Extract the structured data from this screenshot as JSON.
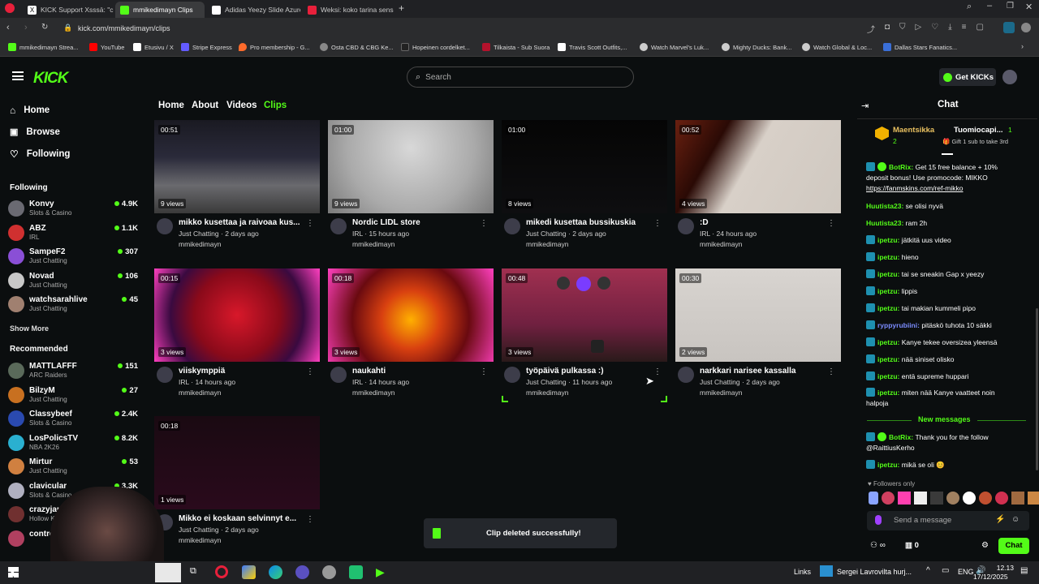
{
  "browser": {
    "tabs": [
      {
        "label": "KICK Support Xsssā: \"chec",
        "color": "#e0e0e0"
      },
      {
        "label": "mmikedimayn Clips",
        "color": "#53fc18"
      },
      {
        "label": "Adidas Yeezy Slide Azure",
        "color": "#ffffff"
      },
      {
        "label": "Weksi: koko tarina sensur",
        "color": "#e8203b"
      }
    ],
    "url": "kick.com/mmikedimayn/clips",
    "bookmarks": [
      {
        "label": "mmikedimayn Strea...",
        "color": "#53fc18"
      },
      {
        "label": "YouTube",
        "color": "#ff0000"
      },
      {
        "label": "Etusivu / X",
        "color": "#ffffff"
      },
      {
        "label": "Stripe Express",
        "color": "#635bff"
      },
      {
        "label": "Pro membership - G...",
        "color": "#ff6b2b"
      },
      {
        "label": "Osta CBD & CBG Ke...",
        "color": "#888888"
      },
      {
        "label": "Hopeinen cordelket...",
        "color": "#222222"
      },
      {
        "label": "Tilkaista - Sub Suora",
        "color": "#b3122c"
      },
      {
        "label": "Travis Scott Outfits,...",
        "color": "#ffffff"
      },
      {
        "label": "Watch Marvel's Luk...",
        "color": "#cccccc"
      },
      {
        "label": "Mighty Ducks: Bank...",
        "color": "#cccccc"
      },
      {
        "label": "Watch Global & Loc...",
        "color": "#cccccc"
      },
      {
        "label": "Dallas Stars Fanatics...",
        "color": "#3a6fd8"
      }
    ]
  },
  "header": {
    "logo": "KICK",
    "search_placeholder": "Search",
    "get_kicks": "Get KICKs"
  },
  "sidebar": {
    "nav": [
      {
        "label": "Home",
        "icon": "home-icon"
      },
      {
        "label": "Browse",
        "icon": "browse-icon"
      },
      {
        "label": "Following",
        "icon": "heart-icon"
      }
    ],
    "following_title": "Following",
    "following": [
      {
        "name": "Konvy",
        "category": "Slots & Casino",
        "viewers": "4.9K",
        "color": "#6a6a72"
      },
      {
        "name": "ABZ",
        "category": "IRL",
        "viewers": "1.1K",
        "color": "#d03030"
      },
      {
        "name": "SampeF2",
        "category": "Just Chatting",
        "viewers": "307",
        "color": "#8a4fd6"
      },
      {
        "name": "Novad",
        "category": "Just Chatting",
        "viewers": "106",
        "color": "#c8c8c8"
      },
      {
        "name": "watchsarahlive",
        "category": "Just Chatting",
        "viewers": "45",
        "color": "#a08070"
      }
    ],
    "show_more": "Show More",
    "recommended_title": "Recommended",
    "recommended": [
      {
        "name": "MATTLAFFF",
        "category": "ARC Raiders",
        "viewers": "151",
        "color": "#5a6a5a"
      },
      {
        "name": "BilzyM",
        "category": "Just Chatting",
        "viewers": "27",
        "color": "#c87020"
      },
      {
        "name": "Classybeef",
        "category": "Slots & Casino",
        "viewers": "2.4K",
        "color": "#2a4ab0"
      },
      {
        "name": "LosPolicsTV",
        "category": "NBA 2K26",
        "viewers": "8.2K",
        "color": "#2ab0d0"
      },
      {
        "name": "Mirtur",
        "category": "Just Chatting",
        "viewers": "53",
        "color": "#d08040"
      },
      {
        "name": "clavicular",
        "category": "Slots & Casino",
        "viewers": "3.3K",
        "color": "#b0b0c0"
      },
      {
        "name": "crazyjapane",
        "category": "Hollow Knigh",
        "viewers": "",
        "color": "#703030"
      },
      {
        "name": "contro",
        "category": "",
        "viewers": "",
        "color": "#b04060"
      }
    ]
  },
  "page_tabs": [
    "Home",
    "About",
    "Videos",
    "Clips"
  ],
  "clips": [
    {
      "duration": "00:51",
      "views": "9 views",
      "title": "mikko kusettaa ja raivoaa kus...",
      "category": "Just Chatting",
      "age": "2 days ago",
      "channel": "mmikedimayn"
    },
    {
      "duration": "01:00",
      "views": "9 views",
      "title": "Nordic LIDL store",
      "category": "IRL",
      "age": "15 hours ago",
      "channel": "mmikedimayn"
    },
    {
      "duration": "01:00",
      "views": "8 views",
      "title": "mikedi kusettaa bussikuskia",
      "category": "Just Chatting",
      "age": "2 days ago",
      "channel": "mmikedimayn"
    },
    {
      "duration": "00:52",
      "views": "4 views",
      "title": ":D",
      "category": "IRL",
      "age": "24 hours ago",
      "channel": "mmikedimayn"
    },
    {
      "duration": "00:15",
      "views": "3 views",
      "title": "viiskymppiä",
      "category": "IRL",
      "age": "14 hours ago",
      "channel": "mmikedimayn"
    },
    {
      "duration": "00:18",
      "views": "3 views",
      "title": "naukahti",
      "category": "IRL",
      "age": "14 hours ago",
      "channel": "mmikedimayn"
    },
    {
      "duration": "00:48",
      "views": "3 views",
      "title": "työpäivä pulkassa :)",
      "category": "Just Chatting",
      "age": "11 hours ago",
      "channel": "mmikedimayn"
    },
    {
      "duration": "00:30",
      "views": "2 views",
      "title": "narkkari narisee kassalla",
      "category": "Just Chatting",
      "age": "2 days ago",
      "channel": "mmikedimayn"
    },
    {
      "duration": "00:18",
      "views": "1 views",
      "title": "Mikko ei koskaan selvinnyt e...",
      "category": "Just Chatting",
      "age": "2 days ago",
      "channel": "mmikedimayn"
    }
  ],
  "toast": "Clip deleted successfully!",
  "chat": {
    "title": "Chat",
    "top_gifter_1": "Maentsikka",
    "top_gifter_1_count": "2",
    "top_gifter_2": "Tuomiocapi...",
    "top_gifter_2_count": "1",
    "gift_text": "Gift 1 sub to take 3rd",
    "messages": [
      {
        "user": "BotRix:",
        "text": "Get 15 free balance + 10% deposit bonus! Use promocode: MIKKO",
        "link": "https://fanmskins.com/ref-mikko",
        "user_color": "#53fc18"
      },
      {
        "user": "Huutista23:",
        "text": "se olisi nyvä",
        "link": "",
        "user_color": "#53fc18"
      },
      {
        "user": "Huutista23:",
        "text": "ram 2h",
        "link": "",
        "user_color": "#53fc18"
      },
      {
        "user": "ipetzu:",
        "text": "jätkitä uus video",
        "link": "",
        "user_color": "#53fc18"
      },
      {
        "user": "ipetzu:",
        "text": "hieno",
        "link": "",
        "user_color": "#53fc18"
      },
      {
        "user": "ipetzu:",
        "text": "tai se sneakin Gap x yeezy",
        "link": "",
        "user_color": "#53fc18"
      },
      {
        "user": "ipetzu:",
        "text": "lippis",
        "link": "",
        "user_color": "#53fc18"
      },
      {
        "user": "ipetzu:",
        "text": "tai makian kummeli pipo",
        "link": "",
        "user_color": "#53fc18"
      },
      {
        "user": "ryppyrubiini:",
        "text": "pitäskö tuhota 10 säkki",
        "link": "",
        "user_color": "#7b8cff"
      },
      {
        "user": "ipetzu:",
        "text": "Kanye tekee oversizea yleensä",
        "link": "",
        "user_color": "#53fc18"
      },
      {
        "user": "ipetzu:",
        "text": "nää siniset olisko",
        "link": "",
        "user_color": "#53fc18"
      },
      {
        "user": "ipetzu:",
        "text": "entä supreme huppari",
        "link": "",
        "user_color": "#53fc18"
      },
      {
        "user": "ipetzu:",
        "text": "miten nää Kanye vaatteet noin halpoja",
        "link": "",
        "user_color": "#53fc18"
      }
    ],
    "new_messages": "New messages",
    "new": [
      {
        "user": "BotRix:",
        "text": "Thank you for the follow @RaittiusKerho",
        "user_color": "#53fc18"
      },
      {
        "user": "ipetzu:",
        "text": "mikä se oli 😊",
        "user_color": "#53fc18"
      }
    ],
    "followers_only": "Followers only",
    "send_placeholder": "Send a message",
    "kicks_count": "0",
    "chat_button": "Chat"
  },
  "taskbar": {
    "links": "Links",
    "news": "Sergei Lavrovilta hurj...",
    "lang": "ENG",
    "time": "12.13",
    "date": "17/12/2025"
  }
}
